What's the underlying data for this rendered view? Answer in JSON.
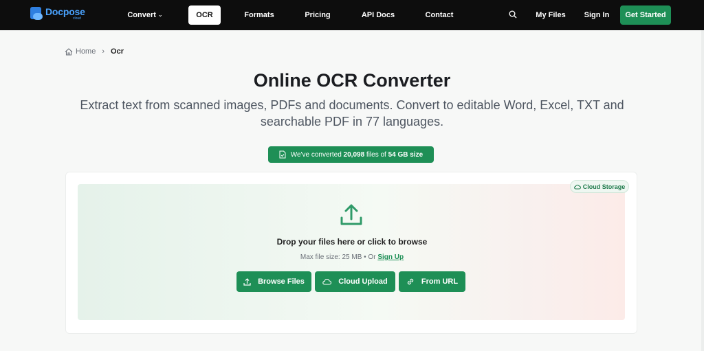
{
  "brand": {
    "name": "Docpose",
    "sub": "cloud"
  },
  "nav": {
    "convert": "Convert",
    "ocr": "OCR",
    "formats": "Formats",
    "pricing": "Pricing",
    "api": "API Docs",
    "contact": "Contact",
    "my_files": "My Files",
    "sign_in": "Sign In",
    "get_started": "Get Started"
  },
  "breadcrumb": {
    "home": "Home",
    "current": "Ocr"
  },
  "hero": {
    "title": "Online OCR Converter",
    "subtitle": "Extract text from scanned images, PDFs and documents. Convert to editable Word, Excel, TXT and searchable PDF in 77 languages."
  },
  "stats": {
    "prefix": "We've converted",
    "files": "20,098",
    "middle": "files of",
    "size": "54 GB size"
  },
  "upload": {
    "cloud_storage": "Cloud Storage",
    "drop_text": "Drop your files here or click to browse",
    "max_size": "Max file size: 25 MB • Or",
    "sign_up": "Sign Up",
    "browse": "Browse Files",
    "cloud_upload": "Cloud Upload",
    "from_url": "From URL"
  },
  "colors": {
    "accent": "#1e8f56",
    "nav_bg": "#0d0d0d"
  }
}
